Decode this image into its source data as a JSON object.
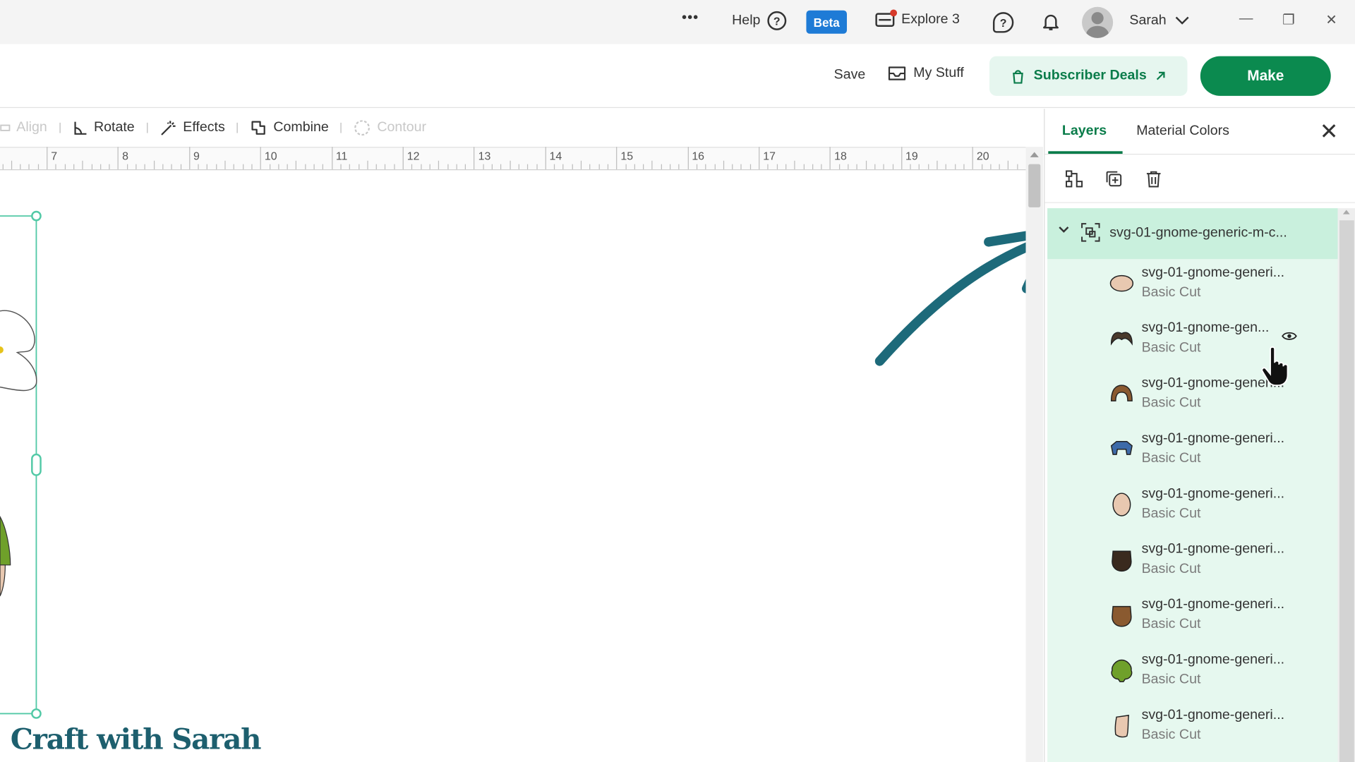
{
  "topbar": {
    "more_label": "•••",
    "help_label": "Help",
    "help_icon_glyph": "?",
    "beta_label": "Beta",
    "machine_label": "Explore 3",
    "support_icon_glyph": "?",
    "user_name": "Sarah",
    "minimize_glyph": "—",
    "restore_glyph": "❐",
    "close_glyph": "✕"
  },
  "header": {
    "save_label": "Save",
    "my_stuff_label": "My Stuff",
    "subscriber_deals_label": "Subscriber Deals",
    "make_label": "Make"
  },
  "toolbar": {
    "align_label": "Align",
    "rotate_label": "Rotate",
    "effects_label": "Effects",
    "combine_label": "Combine",
    "contour_label": "Contour"
  },
  "ruler": {
    "labels": [
      "7",
      "8",
      "9",
      "10",
      "11",
      "12",
      "13",
      "14",
      "15",
      "16",
      "17",
      "18",
      "19",
      "20"
    ]
  },
  "layers_panel": {
    "tabs": [
      "Layers",
      "Material Colors"
    ],
    "active_tab": "Layers",
    "close_glyph": "✕",
    "group_name": "svg-01-gnome-generic-m-c...",
    "layers": [
      {
        "name": "svg-01-gnome-generi...",
        "operation": "Basic Cut",
        "color": "#e8c8b0",
        "icon": "oval-shape-icon"
      },
      {
        "name": "svg-01-gnome-gen...",
        "operation": "Basic Cut",
        "color": "#4a3a2c",
        "icon": "mustache-shape-icon"
      },
      {
        "name": "svg-01-gnome-generi...",
        "operation": "Basic Cut",
        "color": "#8a5a30",
        "icon": "hair-shape-icon"
      },
      {
        "name": "svg-01-gnome-generi...",
        "operation": "Basic Cut",
        "color": "#3d6aa8",
        "icon": "shirt-shape-icon"
      },
      {
        "name": "svg-01-gnome-generi...",
        "operation": "Basic Cut",
        "color": "#e8c8b0",
        "icon": "egg-shape-icon"
      },
      {
        "name": "svg-01-gnome-generi...",
        "operation": "Basic Cut",
        "color": "#3a2a1e",
        "icon": "beard-shape-icon"
      },
      {
        "name": "svg-01-gnome-generi...",
        "operation": "Basic Cut",
        "color": "#8a5a30",
        "icon": "beard-shape-icon"
      },
      {
        "name": "svg-01-gnome-generi...",
        "operation": "Basic Cut",
        "color": "#6fa02a",
        "icon": "tree-shape-icon"
      },
      {
        "name": "svg-01-gnome-generi...",
        "operation": "Basic Cut",
        "color": "#e8c8b0",
        "icon": "ear-shape-icon"
      }
    ]
  },
  "watermark": "Craft with Sarah",
  "colors": {
    "accent_green": "#0b8a4f",
    "selection_green": "#c9f0dd",
    "list_background": "#e6f8ef",
    "arrow": "#1d6a7a",
    "beta_blue": "#1e7bd6"
  }
}
